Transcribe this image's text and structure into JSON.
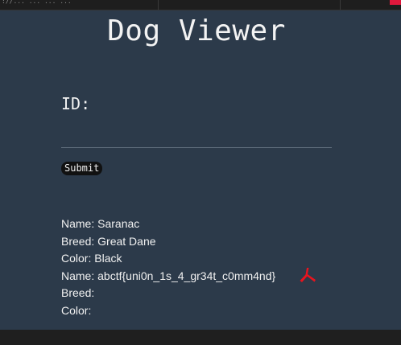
{
  "browser": {
    "url_text": "://...  ...  ...  ..."
  },
  "page": {
    "title": "Dog Viewer",
    "id_label": "ID:",
    "id_value": "",
    "submit_label": "Submit"
  },
  "results": [
    {
      "label": "Name:",
      "value": "Saranac"
    },
    {
      "label": "Breed:",
      "value": "Great Dane"
    },
    {
      "label": "Color:",
      "value": "Black"
    },
    {
      "label": "Name:",
      "value": "abctf{uni0n_1s_4_gr34t_c0mm4nd}"
    },
    {
      "label": "Breed:",
      "value": ""
    },
    {
      "label": "Color:",
      "value": ""
    }
  ],
  "colors": {
    "background": "#2c3a4a",
    "cursor_icon": "#e8141e",
    "bar": "#1e1e1e"
  },
  "icons": {
    "cursor": "red-pointer-icon"
  }
}
